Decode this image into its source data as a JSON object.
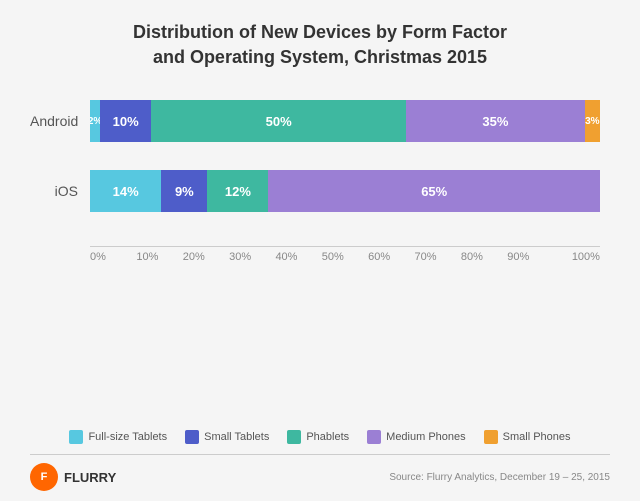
{
  "title": {
    "line1": "Distribution of New Devices by Form Factor",
    "line2": "and Operating System, Christmas 2015"
  },
  "bars": [
    {
      "label": "Android",
      "segments": [
        {
          "label": "2%",
          "pct": 2,
          "color": "#57c8e0",
          "type": "full-tablet"
        },
        {
          "label": "10%",
          "pct": 10,
          "color": "#4e5dc9",
          "type": "small-tablet"
        },
        {
          "label": "50%",
          "pct": 50,
          "color": "#3eb8a0",
          "type": "phablet"
        },
        {
          "label": "35%",
          "pct": 35,
          "color": "#9b7fd4",
          "type": "medium-phone"
        },
        {
          "label": "3%",
          "pct": 3,
          "color": "#f0a030",
          "type": "small-phone"
        }
      ]
    },
    {
      "label": "iOS",
      "segments": [
        {
          "label": "14%",
          "pct": 14,
          "color": "#57c8e0",
          "type": "full-tablet"
        },
        {
          "label": "9%",
          "pct": 9,
          "color": "#4e5dc9",
          "type": "small-tablet"
        },
        {
          "label": "12%",
          "pct": 12,
          "color": "#3eb8a0",
          "type": "phablet"
        },
        {
          "label": "65%",
          "pct": 65,
          "color": "#9b7fd4",
          "type": "medium-phone"
        }
      ]
    }
  ],
  "xAxis": {
    "ticks": [
      "0%",
      "10%",
      "20%",
      "30%",
      "40%",
      "50%",
      "60%",
      "70%",
      "80%",
      "90%",
      "100%"
    ]
  },
  "legend": [
    {
      "label": "Full-size Tablets",
      "color": "#57c8e0"
    },
    {
      "label": "Small Tablets",
      "color": "#4e5dc9"
    },
    {
      "label": "Phablets",
      "color": "#3eb8a0"
    },
    {
      "label": "Medium Phones",
      "color": "#9b7fd4"
    },
    {
      "label": "Small Phones",
      "color": "#f0a030"
    }
  ],
  "footer": {
    "logo": "FLURRY",
    "source": "Source: Flurry Analytics, December 19 – 25, 2015"
  }
}
